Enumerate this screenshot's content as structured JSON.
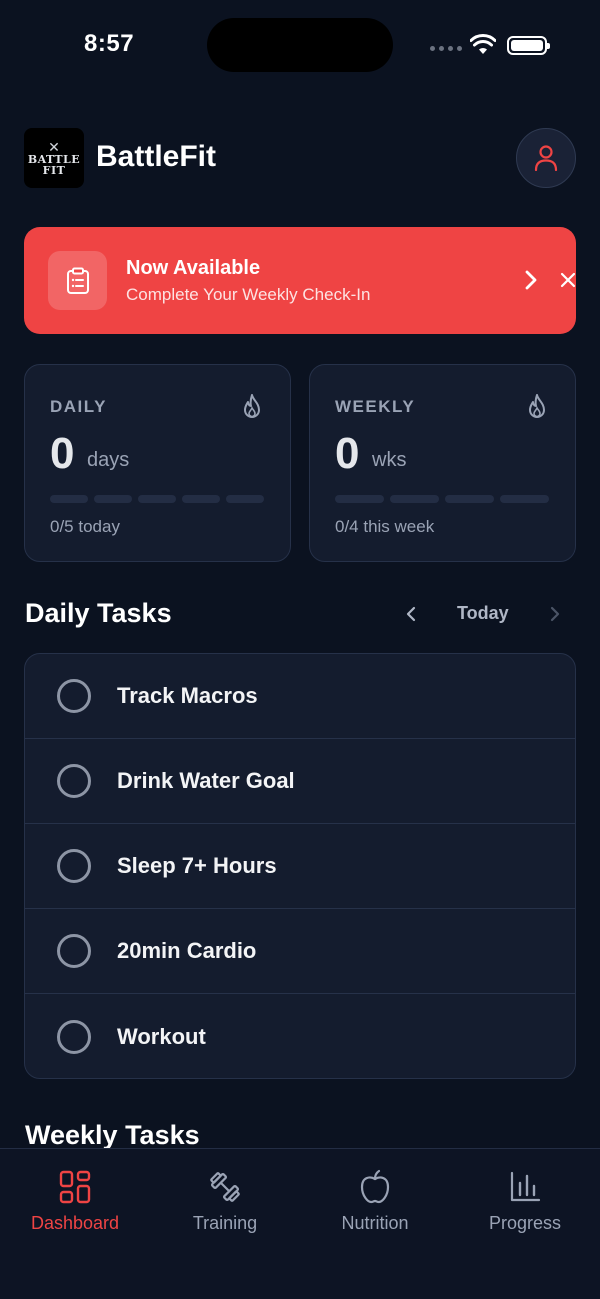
{
  "status_bar": {
    "time": "8:57"
  },
  "header": {
    "logo_text_top": "BATTLE",
    "logo_text_bottom": "FIT",
    "title": "BattleFit"
  },
  "banner": {
    "title": "Now Available",
    "subtitle": "Complete Your Weekly Check-In",
    "color": "#ef4444"
  },
  "streaks": {
    "daily": {
      "label": "DAILY",
      "value": "0",
      "unit": "days",
      "progress_text": "0/5 today",
      "completed": 0,
      "total": 5
    },
    "weekly": {
      "label": "WEEKLY",
      "value": "0",
      "unit": "wks",
      "progress_text": "0/4 this week",
      "completed": 0,
      "total": 4
    }
  },
  "daily_tasks": {
    "title": "Daily Tasks",
    "day_label": "Today",
    "items": [
      {
        "label": "Track Macros",
        "done": false
      },
      {
        "label": "Drink Water Goal",
        "done": false
      },
      {
        "label": "Sleep 7+ Hours",
        "done": false
      },
      {
        "label": "20min Cardio",
        "done": false
      },
      {
        "label": "Workout",
        "done": false
      }
    ]
  },
  "weekly_tasks": {
    "title": "Weekly Tasks"
  },
  "tab_bar": {
    "active": "dashboard",
    "accent": "#ef4444",
    "tabs": [
      {
        "id": "dashboard",
        "label": "Dashboard",
        "icon": "dashboard-grid-icon"
      },
      {
        "id": "training",
        "label": "Training",
        "icon": "dumbbell-icon"
      },
      {
        "id": "nutrition",
        "label": "Nutrition",
        "icon": "apple-icon"
      },
      {
        "id": "progress",
        "label": "Progress",
        "icon": "bar-chart-icon"
      }
    ]
  }
}
